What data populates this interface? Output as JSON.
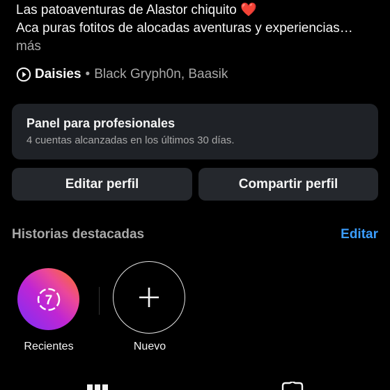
{
  "profile": {
    "bio_line1_text": "Las patoaventuras de Alastor chiquito",
    "bio_line1_emoji": "❤️",
    "bio_line2": "Aca puras fotitos de alocadas aventuras y experiencias…",
    "more_label": "más",
    "music": {
      "icon": "play-circle-icon",
      "song": "Daisies",
      "separator": "•",
      "artists": "Black Gryph0n, Baasik"
    }
  },
  "pro_panel": {
    "title": "Panel para profesionales",
    "subtitle": "4 cuentas alcanzadas en los últimos 30 días."
  },
  "buttons": {
    "edit_profile": "Editar perfil",
    "share_profile": "Compartir perfil"
  },
  "highlights": {
    "title": "Historias destacadas",
    "edit_label": "Editar",
    "items": [
      {
        "label": "Recientes",
        "icon": "recent-days-icon",
        "badge": "7"
      },
      {
        "label": "Nuevo",
        "icon": "plus-icon"
      }
    ]
  },
  "tabs": {
    "icons": [
      "grid-icon",
      "tagged-icon"
    ]
  },
  "colors": {
    "background": "#000000",
    "panel": "#1f2227",
    "button": "#25282d",
    "accent_link": "#3b9eff",
    "muted_text": "#a8a8a8"
  }
}
